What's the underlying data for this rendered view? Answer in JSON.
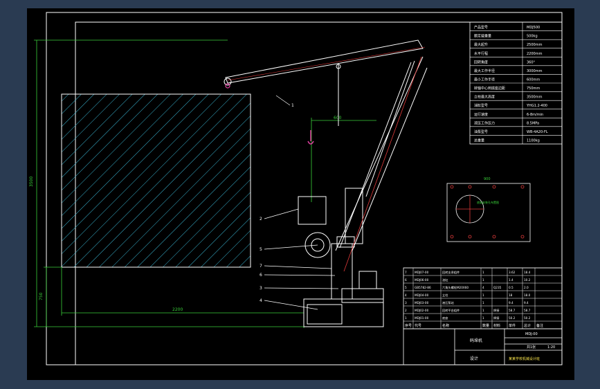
{
  "title_block": {
    "title": "码垛机",
    "drawing_no": "MDJ-00",
    "scale": "1:20",
    "sheet": "共1张",
    "designer": "设计",
    "school": "某某学校机械设计班"
  },
  "spec_table": [
    {
      "label": "产品型号",
      "value": "MDJ500"
    },
    {
      "label": "额定载重量",
      "value": "500kg"
    },
    {
      "label": "最大起升",
      "value": "2500mm"
    },
    {
      "label": "水平行程",
      "value": "2200mm"
    },
    {
      "label": "回转角度",
      "value": "360°"
    },
    {
      "label": "最大工作半径",
      "value": "3000mm"
    },
    {
      "label": "最小工作半径",
      "value": "600mm"
    },
    {
      "label": "转轴中心到底座边距",
      "value": "750mm"
    },
    {
      "label": "立柱最大高度",
      "value": "3500mm"
    },
    {
      "label": "油缸型号",
      "value": "YHG1.2-400"
    },
    {
      "label": "运行速度",
      "value": "6-8m/min"
    },
    {
      "label": "液压工作压力",
      "value": "8.5MPa"
    },
    {
      "label": "油泵型号",
      "value": "WB-4A20-FL"
    },
    {
      "label": "总重量",
      "value": "1100kg"
    }
  ],
  "parts_list": [
    {
      "no": "7",
      "code": "MDJ07-00",
      "name": "回转支承组件",
      "qty": "1",
      "material": "",
      "weight": "3.62",
      "total": "18.4"
    },
    {
      "no": "6",
      "code": "MDJ06-00",
      "name": "油缸",
      "qty": "1",
      "material": "",
      "weight": "1.4",
      "total": "10.2"
    },
    {
      "no": "5",
      "code": "GB5782-86",
      "name": "六角头螺栓M20X60",
      "qty": "4",
      "material": "Q235",
      "weight": "0.5",
      "total": "2.0"
    },
    {
      "no": "4",
      "code": "MDJ04-00",
      "name": "立柱",
      "qty": "1",
      "material": "",
      "weight": "18",
      "total": "18.0"
    },
    {
      "no": "3",
      "code": "MDJ03-00",
      "name": "液压泵站",
      "qty": "1",
      "material": "",
      "weight": "9.4",
      "total": "9.4"
    },
    {
      "no": "2",
      "code": "MDJ02-00",
      "name": "回转平台组件",
      "qty": "1",
      "material": "焊接",
      "weight": "58.7",
      "total": "58.7"
    },
    {
      "no": "1",
      "code": "MDJ01-00",
      "name": "底座",
      "qty": "1",
      "material": "焊接",
      "weight": "50.2",
      "total": "50.2"
    }
  ],
  "parts_header": {
    "no": "序号",
    "code": "代号",
    "name": "名称",
    "qty": "数量",
    "material": "材料",
    "weight": "单件",
    "total": "总计",
    "note": "备注"
  },
  "balloons": [
    "1",
    "2",
    "3",
    "4",
    "5",
    "6",
    "7"
  ],
  "dimensions": {
    "total_height": "3500",
    "base_height": "750",
    "work_width": "2200",
    "boom_offset": "600",
    "plate_width": "900"
  },
  "plate_label": "底板安装孔布置图",
  "colors": {
    "frame": "#ffffff",
    "hatch": "#39b7d4",
    "dimension": "#3ad13a",
    "centerline": "#e23b3b",
    "text": "#ffffff",
    "label": "#f6e24a",
    "hook": "#e040a0"
  }
}
